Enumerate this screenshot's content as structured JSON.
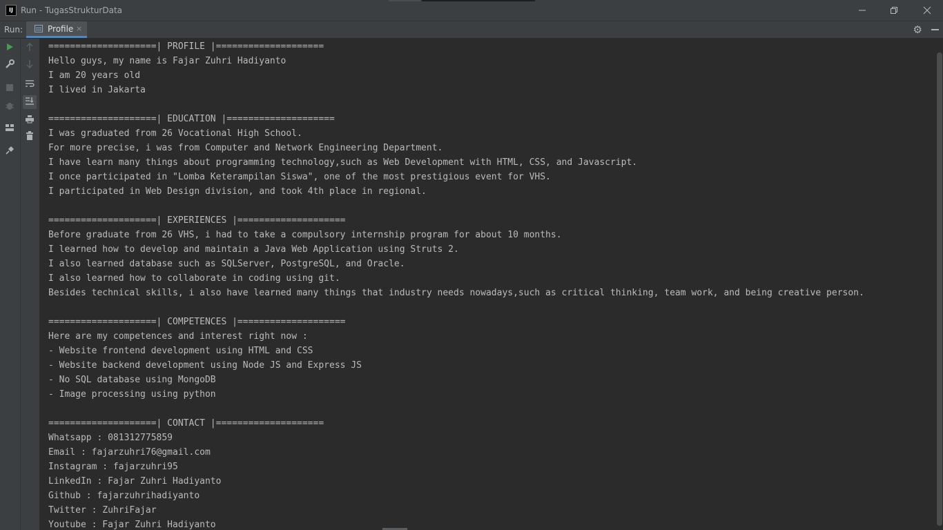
{
  "window": {
    "app_logo": "IJ",
    "title": "Run - TugasStrukturData",
    "minimize_icon": "minimize-icon",
    "restore_icon": "restore-icon",
    "close_icon": "close-icon"
  },
  "run_panel": {
    "label": "Run:",
    "tab": {
      "label": "Profile",
      "close": "×",
      "icon": "console-icon"
    },
    "settings_icon": "gear-icon",
    "hide_icon": "minus-icon"
  },
  "toolbar_left": [
    "rerun-icon",
    "wrench-icon",
    "stop-icon",
    "debug-icon",
    "layout-icon",
    "pin-icon"
  ],
  "toolbar_right": [
    "up-arrow-icon",
    "down-arrow-icon",
    "soft-wrap-icon",
    "scroll-to-end-icon",
    "print-icon",
    "trash-icon"
  ],
  "console": {
    "lines": [
      "====================| PROFILE |====================",
      "Hello guys, my name is Fajar Zuhri Hadiyanto",
      "I am 20 years old",
      "I lived in Jakarta",
      "",
      "====================| EDUCATION |====================",
      "I was graduated from 26 Vocational High School.",
      "For more precise, i was from Computer and Network Engineering Department.",
      "I have learn many things about programming technology,such as Web Development with HTML, CSS, and Javascript.",
      "I once participated in \"Lomba Keterampilan Siswa\", one of the most prestigious event for VHS.",
      "I participated in Web Design division, and took 4th place in regional.",
      "",
      "====================| EXPERIENCES |====================",
      "Before graduate from 26 VHS, i had to take a compulsory internship program for about 10 months.",
      "I learned how to develop and maintain a Java Web Application using Struts 2.",
      "I also learned database such as SQLServer, PostgreSQL, and Oracle.",
      "I also learned how to collaborate in coding using git.",
      "Besides technical skills, i also have learned many things that industry needs nowadays,such as critical thinking, team work, and being creative person.",
      "",
      "====================| COMPETENCES |====================",
      "Here are my competences and interest right now :",
      "- Website frontend development using HTML and CSS",
      "- Website backend development using Node JS and Express JS",
      "- No SQL database using MongoDB",
      "- Image processing using python",
      "",
      "====================| CONTACT |====================",
      "Whatsapp : 081312775859",
      "Email : fajarzuhri76@gmail.com",
      "Instagram : fajarzuhri95",
      "LinkedIn : Fajar Zuhri Hadiyanto",
      "Github : fajarzuhrihadiyanto",
      "Twitter : ZuhriFajar",
      "Youtube : Fajar Zuhri Hadiyanto"
    ]
  },
  "colors": {
    "background": "#2b2b2b",
    "panel": "#3c3f41",
    "text": "#bbbbbb",
    "tab_active": "#4e5254",
    "tab_underline": "#4a88c7",
    "run_green": "#499c54"
  }
}
